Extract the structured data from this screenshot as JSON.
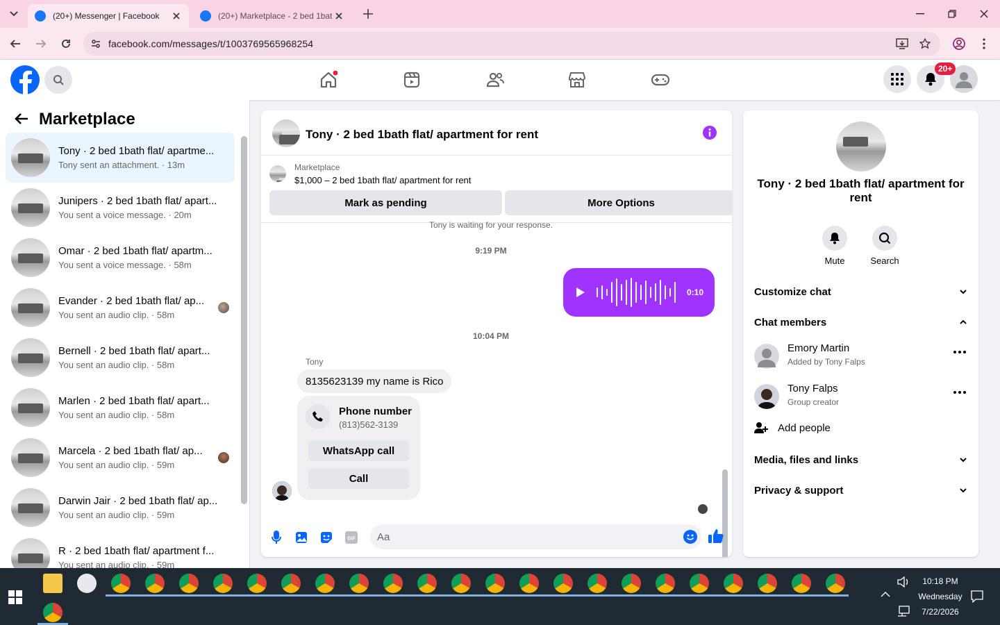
{
  "browser": {
    "tabs": [
      {
        "label": "(20+) Messenger | Facebook",
        "active": true
      },
      {
        "label": "(20+) Marketplace - 2 bed 1bat",
        "active": false
      }
    ],
    "url": "facebook.com/messages/t/1003769565968254"
  },
  "header": {
    "notification_badge": "20+",
    "nav_icons": [
      "home-icon",
      "video-icon",
      "friends-icon",
      "marketplace-icon",
      "gaming-icon"
    ]
  },
  "sidebar": {
    "title": "Marketplace",
    "conversations": [
      {
        "title": "Tony · 2 bed 1bath flat/ apartme...",
        "subtitle": "Tony sent an attachment. · 13m",
        "active": true
      },
      {
        "title": "Junipers · 2 bed 1bath flat/ apart...",
        "subtitle": "You sent a voice message. · 20m"
      },
      {
        "title": "Omar · 2 bed 1bath flat/ apartm...",
        "subtitle": "You sent a voice message. · 58m"
      },
      {
        "title": "Evander · 2 bed 1bath flat/ ap...",
        "subtitle": "You sent an audio clip. · 58m"
      },
      {
        "title": "Bernell · 2 bed 1bath flat/ apart...",
        "subtitle": "You sent an audio clip. · 58m"
      },
      {
        "title": "Marlen · 2 bed 1bath flat/ apart...",
        "subtitle": "You sent an audio clip. · 58m"
      },
      {
        "title": "Marcela · 2 bed 1bath flat/ ap...",
        "subtitle": "You sent an audio clip. · 59m"
      },
      {
        "title": "Darwin Jair · 2 bed 1bath flat/ ap...",
        "subtitle": "You sent an audio clip. · 59m"
      },
      {
        "title": "R · 2 bed 1bath flat/ apartment f...",
        "subtitle": "You sent an audio clip. · 59m"
      }
    ]
  },
  "chat": {
    "title": "Tony · 2 bed 1bath flat/ apartment for rent",
    "marketplace_label": "Marketplace",
    "listing": "$1,000 – 2 bed 1bath flat/ apartment for rent",
    "mark_pending": "Mark as pending",
    "more_options": "More Options",
    "waiting_note": "Tony is waiting for your response.",
    "time1": "9:19 PM",
    "voice_duration": "0:10",
    "time2": "10:04 PM",
    "sender": "Tony",
    "message": "8135623139 my name is Rico",
    "phone_card_title": "Phone number",
    "phone_card_number": "(813)562-3139",
    "whatsapp_call": "WhatsApp call",
    "call": "Call",
    "composer_placeholder": "Aa",
    "accent_color": "#a033ff"
  },
  "details": {
    "name": "Tony · 2 bed 1bath flat/ apartment for rent",
    "mute": "Mute",
    "search": "Search",
    "customize_chat": "Customize chat",
    "chat_members": "Chat members",
    "members": [
      {
        "name": "Emory Martin",
        "role": "Added by Tony Falps"
      },
      {
        "name": "Tony Falps",
        "role": "Group creator"
      }
    ],
    "add_people": "Add people",
    "media": "Media, files and links",
    "privacy": "Privacy & support"
  },
  "taskbar": {
    "time": "10:18 PM",
    "day": "Wednesday",
    "date": "7/22/2026"
  }
}
